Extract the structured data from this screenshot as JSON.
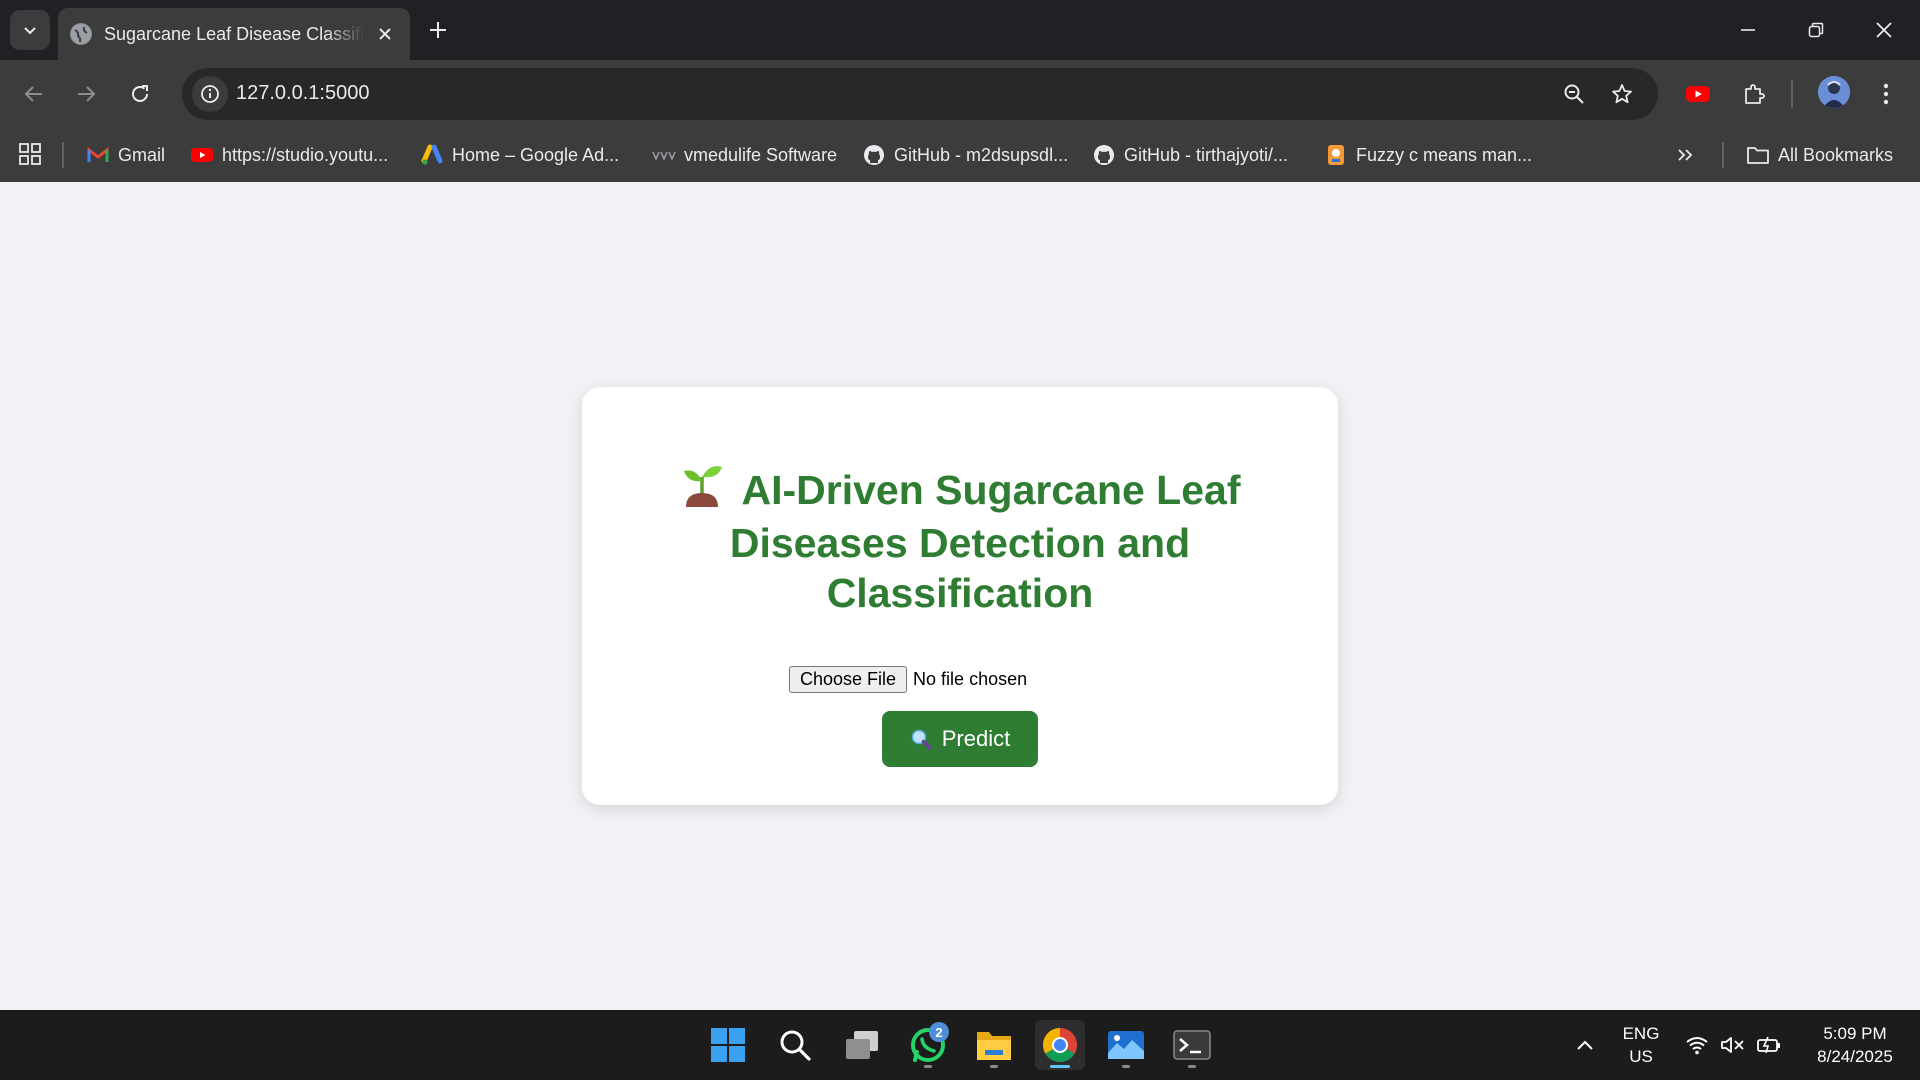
{
  "browser": {
    "tab": {
      "title": "Sugarcane Leaf Disease Classification",
      "favicon": "globe-icon"
    },
    "address_bar": {
      "url": "127.0.0.1:5000"
    },
    "bookmarks": [
      {
        "label": "Gmail",
        "icon": "gmail-icon"
      },
      {
        "label": "https://studio.youtu...",
        "icon": "youtube-icon"
      },
      {
        "label": "Home – Google Ad...",
        "icon": "google-ads-icon"
      },
      {
        "label": "vmedulife Software",
        "icon": "vmedulife-icon"
      },
      {
        "label": "GitHub - m2dsupsdl...",
        "icon": "github-icon"
      },
      {
        "label": "GitHub - tirthajyoti/...",
        "icon": "github-icon"
      },
      {
        "label": "Fuzzy c means man...",
        "icon": "document-icon"
      }
    ],
    "all_bookmarks_label": "All Bookmarks"
  },
  "page": {
    "title_lines": [
      "AI-Driven Sugarcane Leaf",
      "Diseases Detection and",
      "Classification"
    ],
    "title_icon": "seedling-icon",
    "file_input": {
      "button_label": "Choose File",
      "status": "No file chosen"
    },
    "predict_button": {
      "label": "Predict",
      "icon": "magnifier-icon"
    },
    "colors": {
      "accent": "#2e7d32",
      "background": "#f0f2f5"
    }
  },
  "taskbar": {
    "apps": [
      "start-icon",
      "search-icon",
      "task-view-icon",
      "whatsapp-icon",
      "file-explorer-icon",
      "chrome-icon",
      "photos-icon",
      "terminal-icon"
    ],
    "whatsapp_badge": "2",
    "language": {
      "line1": "ENG",
      "line2": "US"
    },
    "clock": {
      "time": "5:09 PM",
      "date": "8/24/2025"
    }
  }
}
